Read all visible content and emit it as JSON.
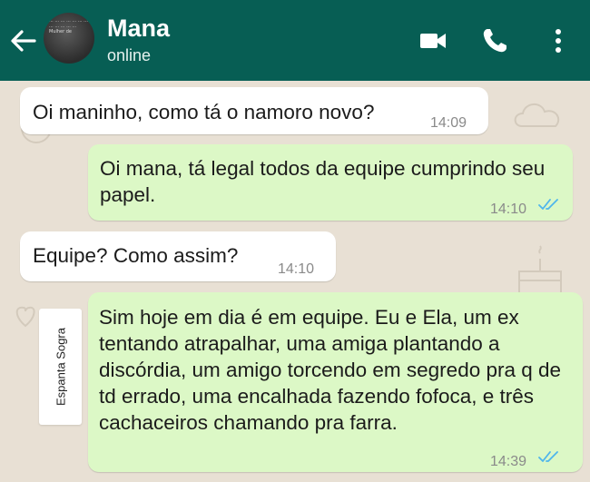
{
  "header": {
    "contact_name": "Mana",
    "status": "online",
    "avatar_text": "... ... ... ... ... ... ... ... ... ... ... ... Mulher de",
    "icons": [
      "back-arrow-icon",
      "video-call-icon",
      "phone-icon",
      "more-vert-icon"
    ]
  },
  "colors": {
    "header": "#075e54",
    "incoming_bubble": "#ffffff",
    "outgoing_bubble": "#dcf8c6",
    "read_ticks": "#4fb5ec",
    "wallpaper": "#e8e0d4"
  },
  "messages": [
    {
      "direction": "incoming",
      "text": "Oi maninho, como tá o namoro novo?",
      "time": "14:09"
    },
    {
      "direction": "outgoing",
      "text": "Oi mana, tá legal todos da equipe cumprindo seu papel.",
      "time": "14:10",
      "status": "read"
    },
    {
      "direction": "incoming",
      "text": "Equipe? Como assim?",
      "time": "14:10"
    },
    {
      "direction": "outgoing",
      "text": "Sim hoje em dia é em equipe. Eu e Ela, um ex tentando atrapalhar, uma amiga plantando a discórdia,   um amigo torcendo em segredo pra q de td errado, uma encalhada fazendo fofoca, e três cachaceiros chamando pra farra.",
      "time": "14:39",
      "status": "read"
    }
  ],
  "sticker_label": "Espanta Sogra"
}
